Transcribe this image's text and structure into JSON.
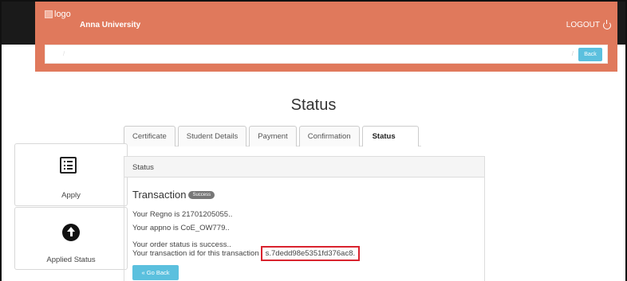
{
  "header": {
    "logo_alt": "logo",
    "brand": "Anna University",
    "logout_label": "LOGOUT"
  },
  "breadcrumb": {
    "path": "/",
    "path_right": "/",
    "back_label": "Back"
  },
  "page": {
    "title": "Status"
  },
  "tabs": [
    {
      "label": "Certificate",
      "active": false
    },
    {
      "label": "Student Details",
      "active": false
    },
    {
      "label": "Payment",
      "active": false
    },
    {
      "label": "Confirmation",
      "active": false
    },
    {
      "label": "Status",
      "active": true
    }
  ],
  "sidebar": {
    "items": [
      {
        "label": "Apply",
        "icon": "list-icon"
      },
      {
        "label": "Applied Status",
        "icon": "upload-circle-icon"
      }
    ]
  },
  "panel": {
    "heading": "Status",
    "transaction_title": "Transaction",
    "badge": "Success",
    "regno_line": "Your Regno is 21701205055..",
    "appno_line": "Your appno is CoE_OW779..",
    "order_status_line": "Your order status is success..",
    "txn_prefix": "Your transaction id for this transaction",
    "txn_id": "s.7dedd98e5351fd376ac8.",
    "go_back_label": "« Go Back"
  },
  "colors": {
    "header_bg": "#e0795c",
    "button_bg": "#5bc0de",
    "highlight_border": "#d9232e"
  }
}
